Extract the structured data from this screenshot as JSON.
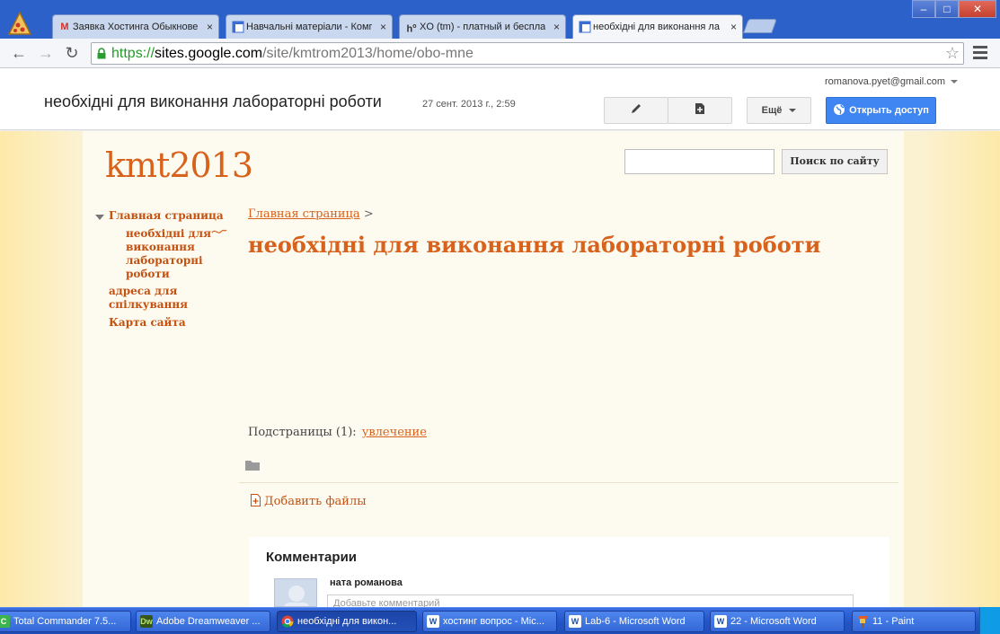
{
  "browser": {
    "tabs": [
      {
        "label": "Заявка Хостинга Обыкнове",
        "icon": "gmail-icon"
      },
      {
        "label": "Навчальні матеріали - Комп",
        "icon": "sites-icon"
      },
      {
        "label": "XO (tm) - платный и беспла",
        "icon": "ho-icon"
      },
      {
        "label": "необхідні для виконання ла",
        "icon": "sites-icon"
      }
    ],
    "close_glyph": "×",
    "url": {
      "scheme": "https://",
      "host": "sites.google.com",
      "path": "/site/kmtrom2013/home/obo-mne"
    }
  },
  "sites_header": {
    "title": "необхідні для виконання лабораторні роботи",
    "date": "27 сент. 2013 г., 2:59",
    "account": "romanova.pyet@gmail.com",
    "more_label": "Ещё",
    "share_label": "Открыть доступ"
  },
  "site": {
    "name": "kmt2013",
    "search_button": "Поиск по сайту",
    "search_value": ""
  },
  "sidebar": {
    "items": [
      {
        "label": "Главная страница"
      },
      {
        "label": "необхідні для"
      },
      {
        "label": "виконання"
      },
      {
        "label": "лабораторні"
      },
      {
        "label": "роботи"
      },
      {
        "label": "адреса для"
      },
      {
        "label": "спілкування"
      },
      {
        "label": "Карта сайта"
      }
    ]
  },
  "main": {
    "breadcrumb_link": "Главная страница",
    "breadcrumb_sep": ">",
    "title": "необхідні для виконання лабораторні роботи",
    "subpages_label": "Подстраницы (1):",
    "subpage_link": "увлечение",
    "add_files": "Добавить файлы"
  },
  "comments": {
    "heading": "Комментарии",
    "author": "ната романова",
    "placeholder": "Добавьте комментарий"
  },
  "taskbar": {
    "items": [
      {
        "label": "Total Commander 7.5...",
        "icon": "total-commander-icon"
      },
      {
        "label": "Adobe Dreamweaver ...",
        "icon": "dreamweaver-icon"
      },
      {
        "label": "необхідні для викон...",
        "icon": "chrome-icon"
      },
      {
        "label": "хостинг вопрос - Mic...",
        "icon": "word-icon"
      },
      {
        "label": "Lab-6 - Microsoft Word",
        "icon": "word-icon"
      },
      {
        "label": "22 - Microsoft Word",
        "icon": "word-icon"
      },
      {
        "label": "11 - Paint",
        "icon": "paint-icon"
      }
    ]
  },
  "colors": {
    "accent": "#d8621c",
    "share_button": "#3f86f2",
    "taskbar": "#2456c8"
  }
}
